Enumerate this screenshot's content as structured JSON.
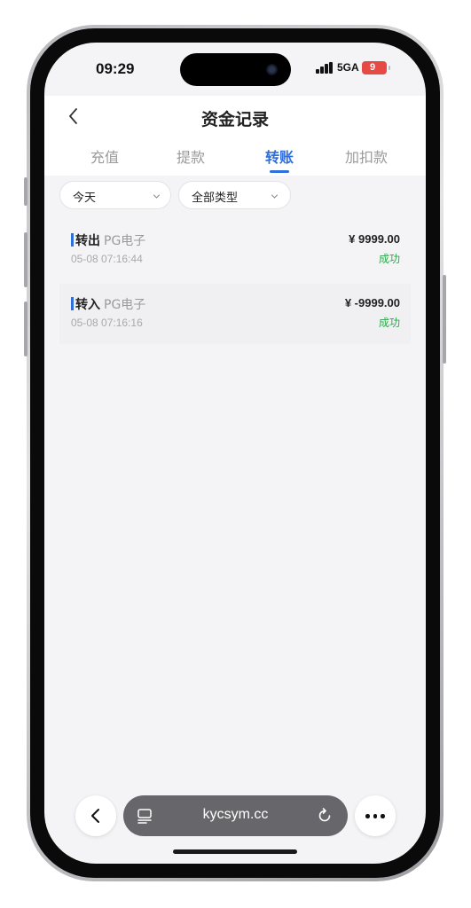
{
  "status_bar": {
    "time": "09:29",
    "network": "5GA",
    "battery": "9",
    "battery_color": "#e64a45"
  },
  "header": {
    "title": "资金记录",
    "tabs": [
      {
        "label": "充值",
        "active": false
      },
      {
        "label": "提款",
        "active": false
      },
      {
        "label": "转账",
        "active": true
      },
      {
        "label": "加扣款",
        "active": false
      }
    ],
    "accent_color": "#2f6fdb"
  },
  "filters": {
    "date": "今天",
    "type": "全部类型"
  },
  "records": [
    {
      "type": "转出",
      "game": "PG电子",
      "time": "05-08 07:16:44",
      "amount": "¥ 9999.00",
      "status": "成功"
    },
    {
      "type": "转入",
      "game": "PG电子",
      "time": "05-08 07:16:16",
      "amount": "¥ -9999.00",
      "status": "成功"
    }
  ],
  "status_color": "#2aa84a",
  "browser": {
    "url": "kycsym.cc",
    "icons": [
      "chevron-left-icon",
      "tabs-icon",
      "reload-icon",
      "more-icon"
    ]
  }
}
